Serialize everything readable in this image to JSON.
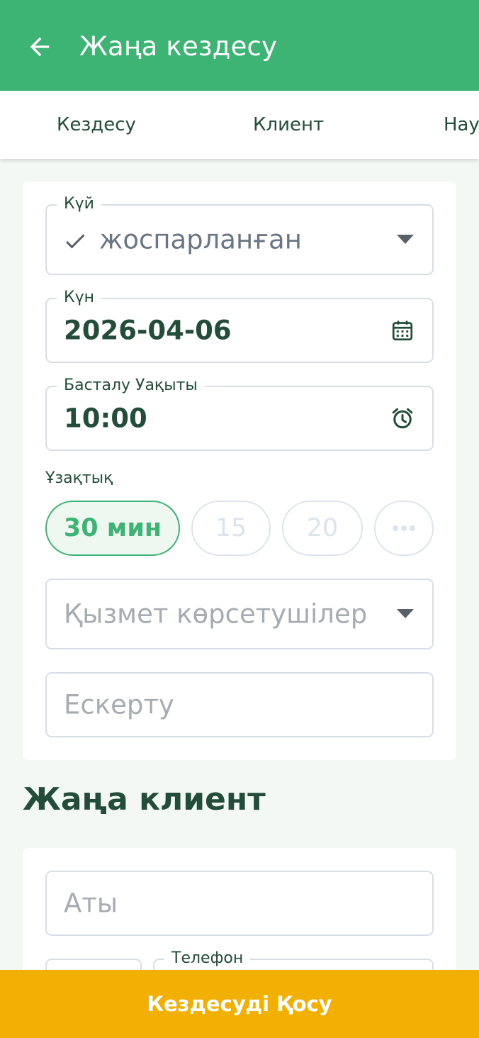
{
  "appbar": {
    "title": "Жаңа кездесу",
    "back_icon": "arrow-left-icon",
    "background": "#3db374"
  },
  "tabs": [
    {
      "label": "Кездесу"
    },
    {
      "label": "Клиент"
    },
    {
      "label": "Нау"
    }
  ],
  "appointment": {
    "status": {
      "label": "Күй",
      "value": "жоспарланған",
      "check_icon": "check-icon"
    },
    "date": {
      "label": "Күн",
      "value": "2026-04-06",
      "icon": "calendar-icon"
    },
    "start_time": {
      "label": "Басталу Уақыты",
      "value": "10:00",
      "icon": "alarm-clock-icon"
    },
    "duration": {
      "label": "Ұзақтық",
      "options": [
        "30 мин",
        "15",
        "20"
      ],
      "selected": "30 мин",
      "more_icon": "more-horizontal-icon"
    },
    "providers": {
      "placeholder": "Қызмет көрсетушілер"
    },
    "note": {
      "placeholder": "Ескерту"
    }
  },
  "new_client": {
    "title": "Жаңа клиент",
    "name": {
      "placeholder": "Аты"
    },
    "phone": {
      "label": "Телефон"
    }
  },
  "submit": {
    "label": "Кездесуді Қосу",
    "background": "#f2b004"
  }
}
